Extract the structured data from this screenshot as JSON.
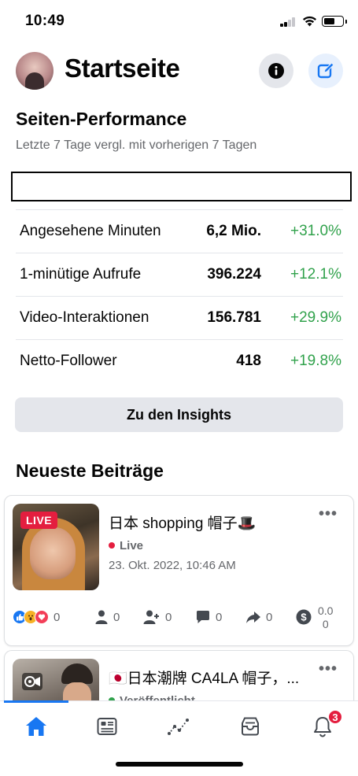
{
  "status_bar": {
    "time": "10:49"
  },
  "header": {
    "title": "Startseite",
    "icons": {
      "avatar": "profile-avatar",
      "info": "info-icon",
      "edit": "compose-icon"
    }
  },
  "performance": {
    "title": "Seiten-Performance",
    "subtitle": "Letzte 7 Tage vergl. mit vorherigen 7 Tagen",
    "stats": [
      {
        "label": "Angesehene Minuten",
        "value": "6,2 Mio.",
        "change": "+31.0%"
      },
      {
        "label": "1-minütige Aufrufe",
        "value": "396.224",
        "change": "+12.1%"
      },
      {
        "label": "Video-Interaktionen",
        "value": "156.781",
        "change": "+29.9%"
      },
      {
        "label": "Netto-Follower",
        "value": "418",
        "change": "+19.8%"
      }
    ],
    "insights_button": "Zu den Insights"
  },
  "recent_posts": {
    "title": "Neueste Beiträge",
    "posts": [
      {
        "badge": "LIVE",
        "title": "日本 shopping 帽子🎩",
        "status": "Live",
        "status_color": "#e41e3f",
        "date": "23. Okt. 2022, 10:46 AM",
        "metrics": {
          "reactions": "0",
          "reach": "0",
          "followers": "0",
          "comments": "0",
          "shares": "0",
          "earnings_top": "0.0",
          "earnings_bottom": "0"
        }
      },
      {
        "title": "🇯🇵日本潮牌 CA4LA 帽子，...",
        "status": "Veröffentlicht",
        "status_color": "#31a24c"
      }
    ]
  },
  "tab_bar": {
    "tabs": [
      "home-icon",
      "feed-icon",
      "insights-icon",
      "inbox-icon",
      "notifications-icon"
    ],
    "notification_count": "3",
    "accent": "#1877f2"
  }
}
